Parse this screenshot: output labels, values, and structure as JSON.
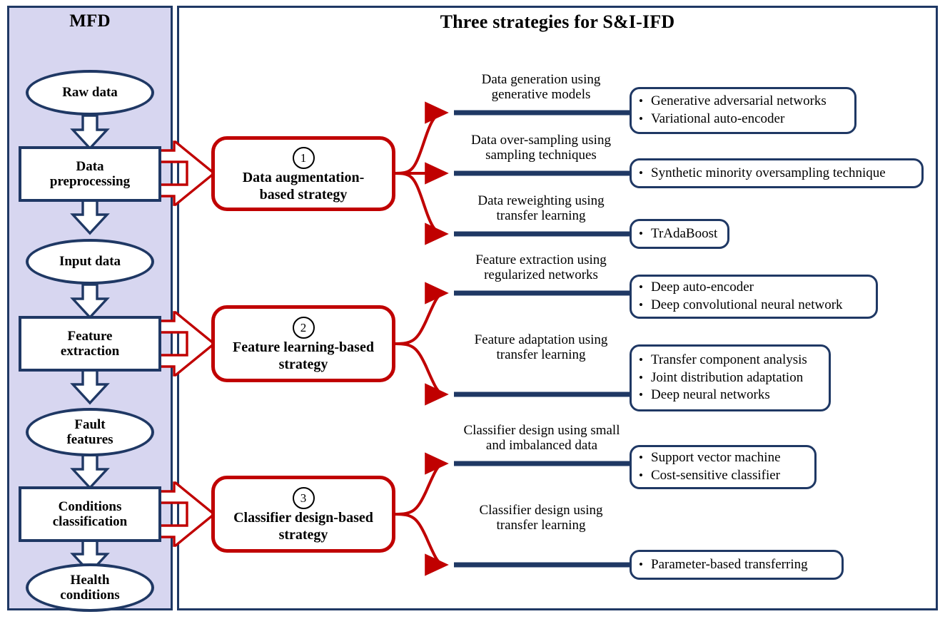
{
  "panels": {
    "mfd": {
      "title": "MFD"
    },
    "strategies": {
      "title": "Three strategies for S&I-IFD"
    }
  },
  "colors": {
    "panel_fill": "#D7D6F0",
    "navy": "#1F3864",
    "red": "#C00000",
    "white": "#FFFFFF"
  },
  "mfd_flow": [
    {
      "id": "raw-data",
      "shape": "oval",
      "label": "Raw data"
    },
    {
      "id": "data-preprocessing",
      "shape": "rect",
      "label": "Data\npreprocessing"
    },
    {
      "id": "input-data",
      "shape": "oval",
      "label": "Input data"
    },
    {
      "id": "feature-extraction",
      "shape": "rect",
      "label": "Feature\nextraction"
    },
    {
      "id": "fault-features",
      "shape": "oval",
      "label": "Fault\nfeatures"
    },
    {
      "id": "conditions-classification",
      "shape": "rect",
      "label": "Conditions\nclassification"
    },
    {
      "id": "health-conditions",
      "shape": "oval",
      "label": "Health\nconditions"
    }
  ],
  "strategies": [
    {
      "number": "1",
      "label": "Data augmentation-\nbased strategy",
      "branches": [
        {
          "caption": "Data generation using\ngenerative models",
          "items": [
            "Generative adversarial networks",
            "Variational auto-encoder"
          ]
        },
        {
          "caption": "Data over-sampling using\nsampling techniques",
          "items": [
            "Synthetic minority oversampling technique"
          ]
        },
        {
          "caption": "Data reweighting using\ntransfer learning",
          "items": [
            "TrAdaBoost"
          ]
        }
      ]
    },
    {
      "number": "2",
      "label": "Feature learning-based\nstrategy",
      "branches": [
        {
          "caption": "Feature extraction using\nregularized networks",
          "items": [
            "Deep auto-encoder",
            "Deep convolutional neural network"
          ]
        },
        {
          "caption": "Feature adaptation using\ntransfer learning",
          "items": [
            "Transfer component analysis",
            "Joint distribution adaptation",
            "Deep neural networks"
          ]
        }
      ]
    },
    {
      "number": "3",
      "label": "Classifier design-based\nstrategy",
      "branches": [
        {
          "caption": "Classifier design using small\nand imbalanced data",
          "items": [
            "Support vector machine",
            "Cost-sensitive classifier"
          ]
        },
        {
          "caption": "Classifier design using\ntransfer learning",
          "items": [
            "Parameter-based transferring"
          ]
        }
      ]
    }
  ]
}
